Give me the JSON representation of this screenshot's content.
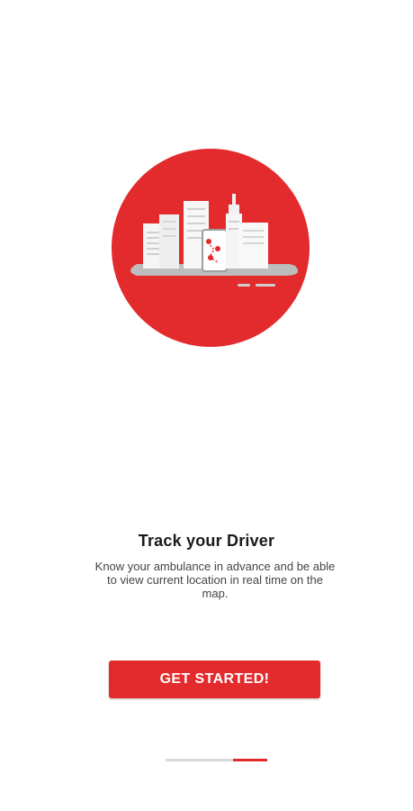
{
  "onboarding": {
    "illustration_icon": "city-tracking-illustration",
    "title": "Track your Driver",
    "description": "Know your ambulance in advance and be able to view current location in real time on the map.",
    "cta_label": "GET STARTED!",
    "pager": {
      "total_pages": 3,
      "active_page": 3
    }
  },
  "colors": {
    "accent": "#e32b2d",
    "text_primary": "#1a1a1a",
    "text_secondary": "#444444",
    "pager_track": "#d9d9d9"
  }
}
